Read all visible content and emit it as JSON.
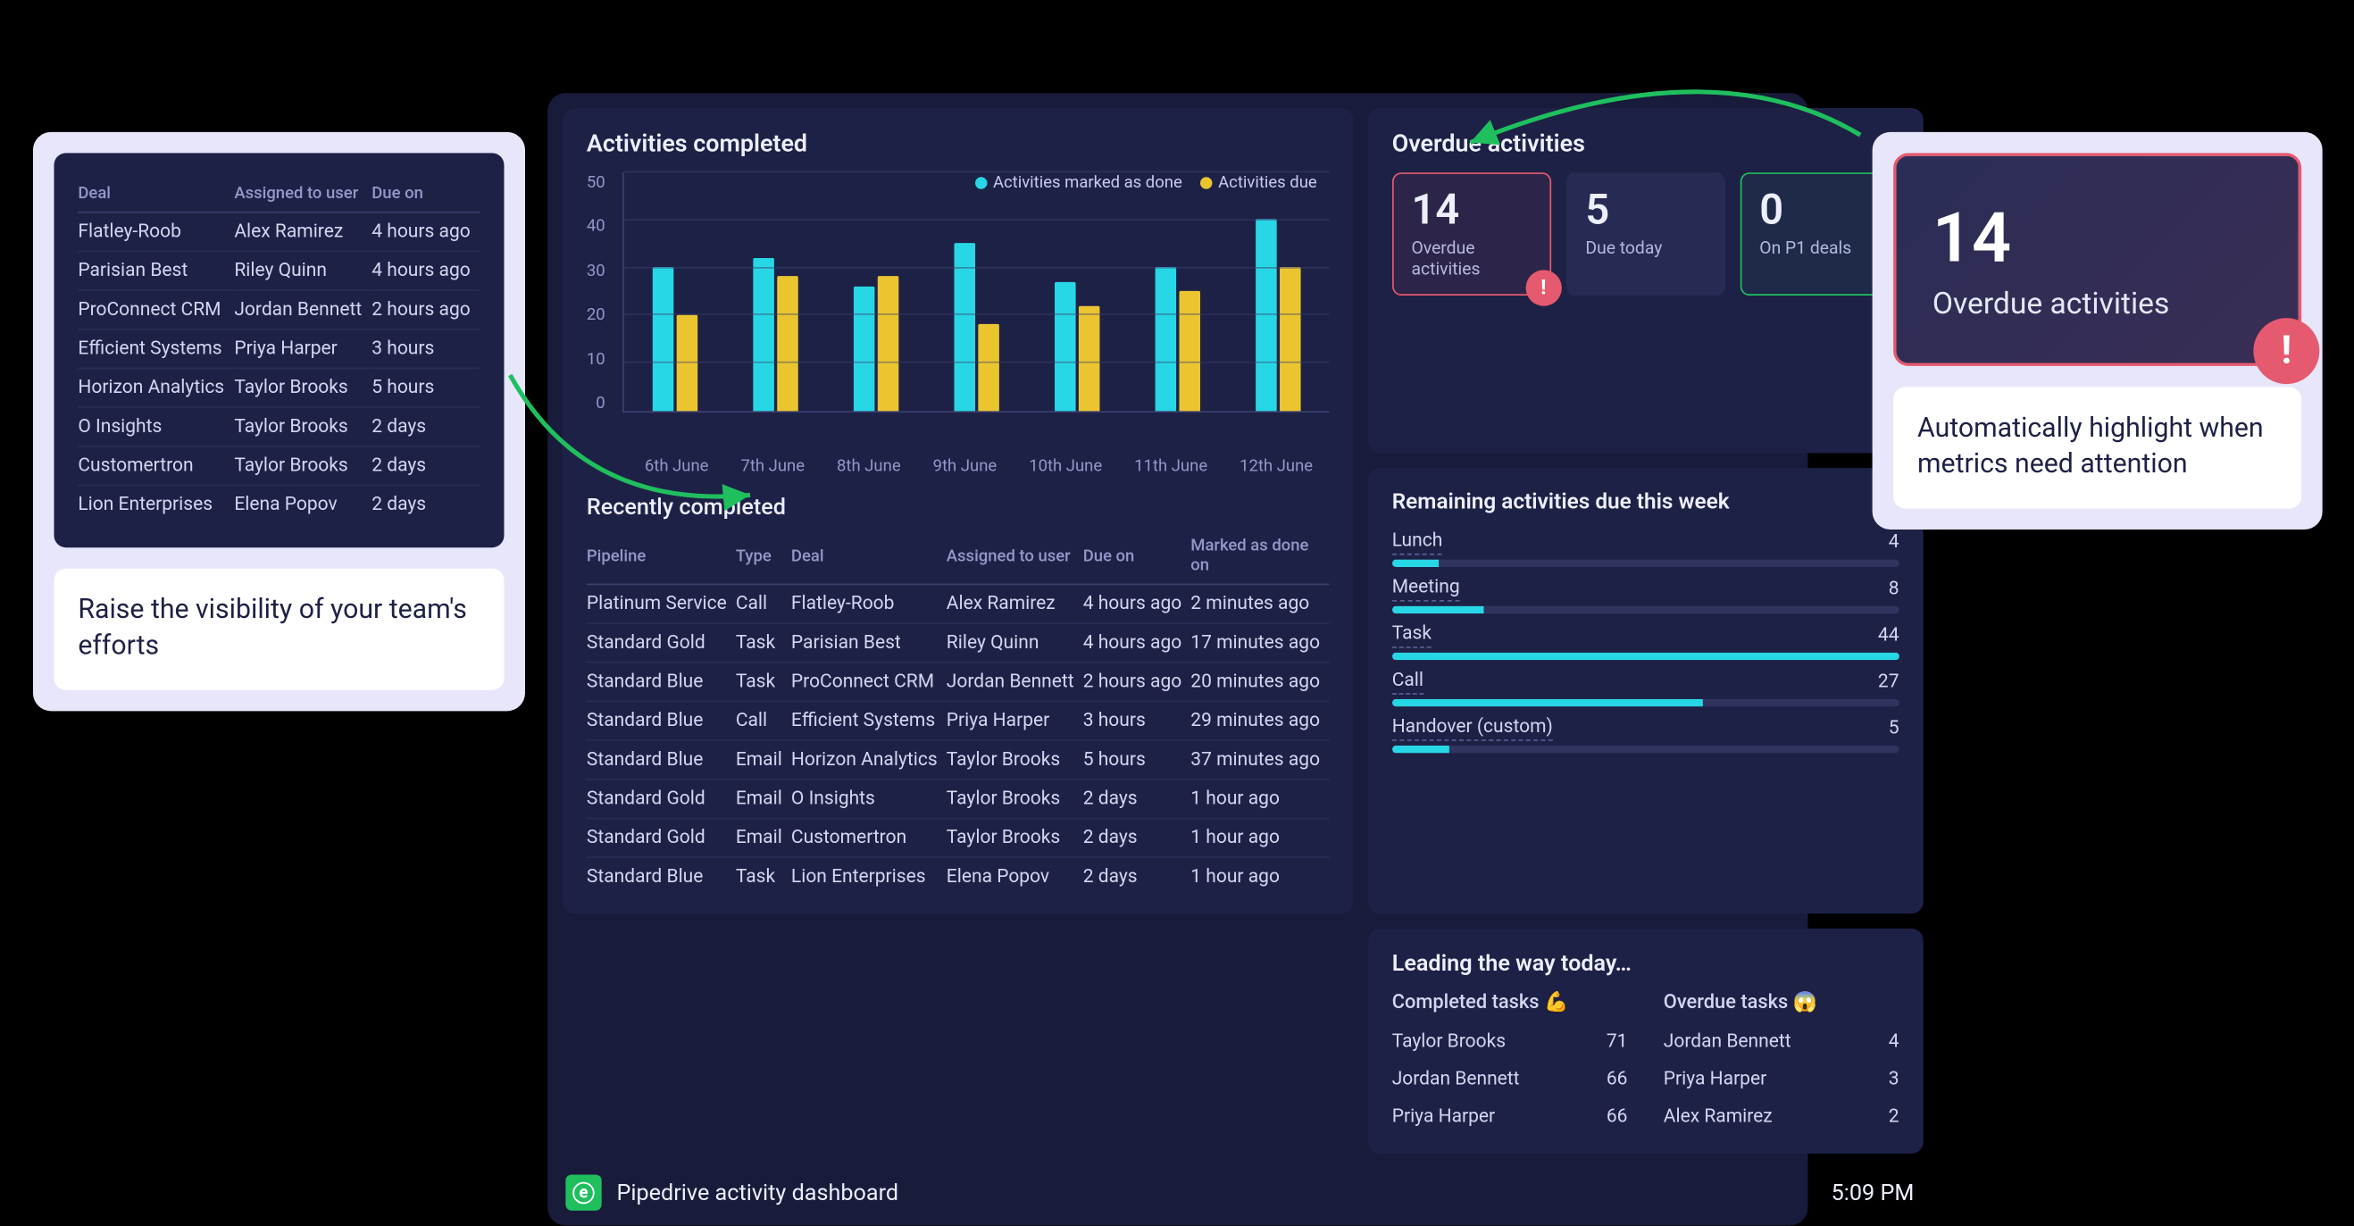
{
  "left_callout": {
    "table": {
      "headers": [
        "Deal",
        "Assigned to user",
        "Due on"
      ],
      "rows": [
        [
          "Flatley-Roob",
          "Alex Ramirez",
          "4 hours ago"
        ],
        [
          "Parisian Best",
          "Riley Quinn",
          "4 hours ago"
        ],
        [
          "ProConnect CRM",
          "Jordan Bennett",
          "2 hours ago"
        ],
        [
          "Efficient Systems",
          "Priya Harper",
          "3 hours"
        ],
        [
          "Horizon Analytics",
          "Taylor Brooks",
          "5 hours"
        ],
        [
          "O Insights",
          "Taylor Brooks",
          "2 days"
        ],
        [
          "Customertron",
          "Taylor Brooks",
          "2 days"
        ],
        [
          "Lion Enterprises",
          "Elena Popov",
          "2 days"
        ]
      ]
    },
    "note": "Raise the visibility of your team's efforts"
  },
  "right_callout": {
    "stat": {
      "value": "14",
      "label": "Overdue activities"
    },
    "note": "Automatically highlight when metrics need attention"
  },
  "dashboard": {
    "activities_completed": {
      "title": "Activities completed",
      "legend": {
        "done": "Activities marked as done",
        "due": "Activities due"
      }
    },
    "recently_completed": {
      "title": "Recently completed",
      "headers": [
        "Pipeline",
        "Type",
        "Deal",
        "Assigned to user",
        "Due on",
        "Marked as done on"
      ],
      "rows": [
        [
          "Platinum Service",
          "Call",
          "Flatley-Roob",
          "Alex Ramirez",
          "4 hours ago",
          "2 minutes ago"
        ],
        [
          "Standard Gold",
          "Task",
          "Parisian Best",
          "Riley Quinn",
          "4 hours ago",
          "17 minutes ago"
        ],
        [
          "Standard Blue",
          "Task",
          "ProConnect CRM",
          "Jordan Bennett",
          "2 hours ago",
          "20 minutes ago"
        ],
        [
          "Standard Blue",
          "Call",
          "Efficient Systems",
          "Priya Harper",
          "3 hours",
          "29 minutes ago"
        ],
        [
          "Standard Blue",
          "Email",
          "Horizon Analytics",
          "Taylor Brooks",
          "5 hours",
          "37 minutes ago"
        ],
        [
          "Standard Gold",
          "Email",
          "O Insights",
          "Taylor Brooks",
          "2 days",
          "1 hour ago"
        ],
        [
          "Standard Gold",
          "Email",
          "Customertron",
          "Taylor Brooks",
          "2 days",
          "1 hour ago"
        ],
        [
          "Standard Blue",
          "Task",
          "Lion Enterprises",
          "Elena Popov",
          "2 days",
          "1 hour ago"
        ]
      ]
    },
    "overdue": {
      "title": "Overdue activities",
      "stats": [
        {
          "value": "14",
          "label": "Overdue activities",
          "variant": "alert"
        },
        {
          "value": "5",
          "label": "Due today",
          "variant": "plain"
        },
        {
          "value": "0",
          "label": "On P1 deals",
          "variant": "good"
        }
      ]
    },
    "remaining": {
      "title": "Remaining activities due this week",
      "max": 44,
      "items": [
        {
          "label": "Lunch",
          "value": 4
        },
        {
          "label": "Meeting",
          "value": 8
        },
        {
          "label": "Task",
          "value": 44
        },
        {
          "label": "Call",
          "value": 27
        },
        {
          "label": "Handover (custom)",
          "value": 5
        }
      ]
    },
    "leading": {
      "title": "Leading the way today…",
      "completed": {
        "header": "Completed tasks 💪",
        "rows": [
          [
            "Taylor Brooks",
            "71"
          ],
          [
            "Jordan Bennett",
            "66"
          ],
          [
            "Priya Harper",
            "66"
          ]
        ]
      },
      "overdue_col": {
        "header": "Overdue tasks 😱",
        "rows": [
          [
            "Jordan Bennett",
            "4"
          ],
          [
            "Priya Harper",
            "3"
          ],
          [
            "Alex Ramirez",
            "2"
          ]
        ]
      }
    },
    "footer": {
      "title": "Pipedrive activity dashboard",
      "time": "5:09 PM"
    }
  },
  "chart_data": {
    "type": "bar",
    "title": "Activities completed",
    "categories": [
      "6th June",
      "7th June",
      "8th June",
      "9th June",
      "10th June",
      "11th June",
      "12th June"
    ],
    "series": [
      {
        "name": "Activities marked as done",
        "values": [
          30,
          32,
          26,
          35,
          27,
          30,
          40
        ]
      },
      {
        "name": "Activities due",
        "values": [
          20,
          28,
          28,
          18,
          22,
          25,
          30
        ]
      }
    ],
    "ylabel": "",
    "xlabel": "",
    "ylim": [
      0,
      50
    ],
    "yticks": [
      0,
      10,
      20,
      30,
      40,
      50
    ]
  }
}
